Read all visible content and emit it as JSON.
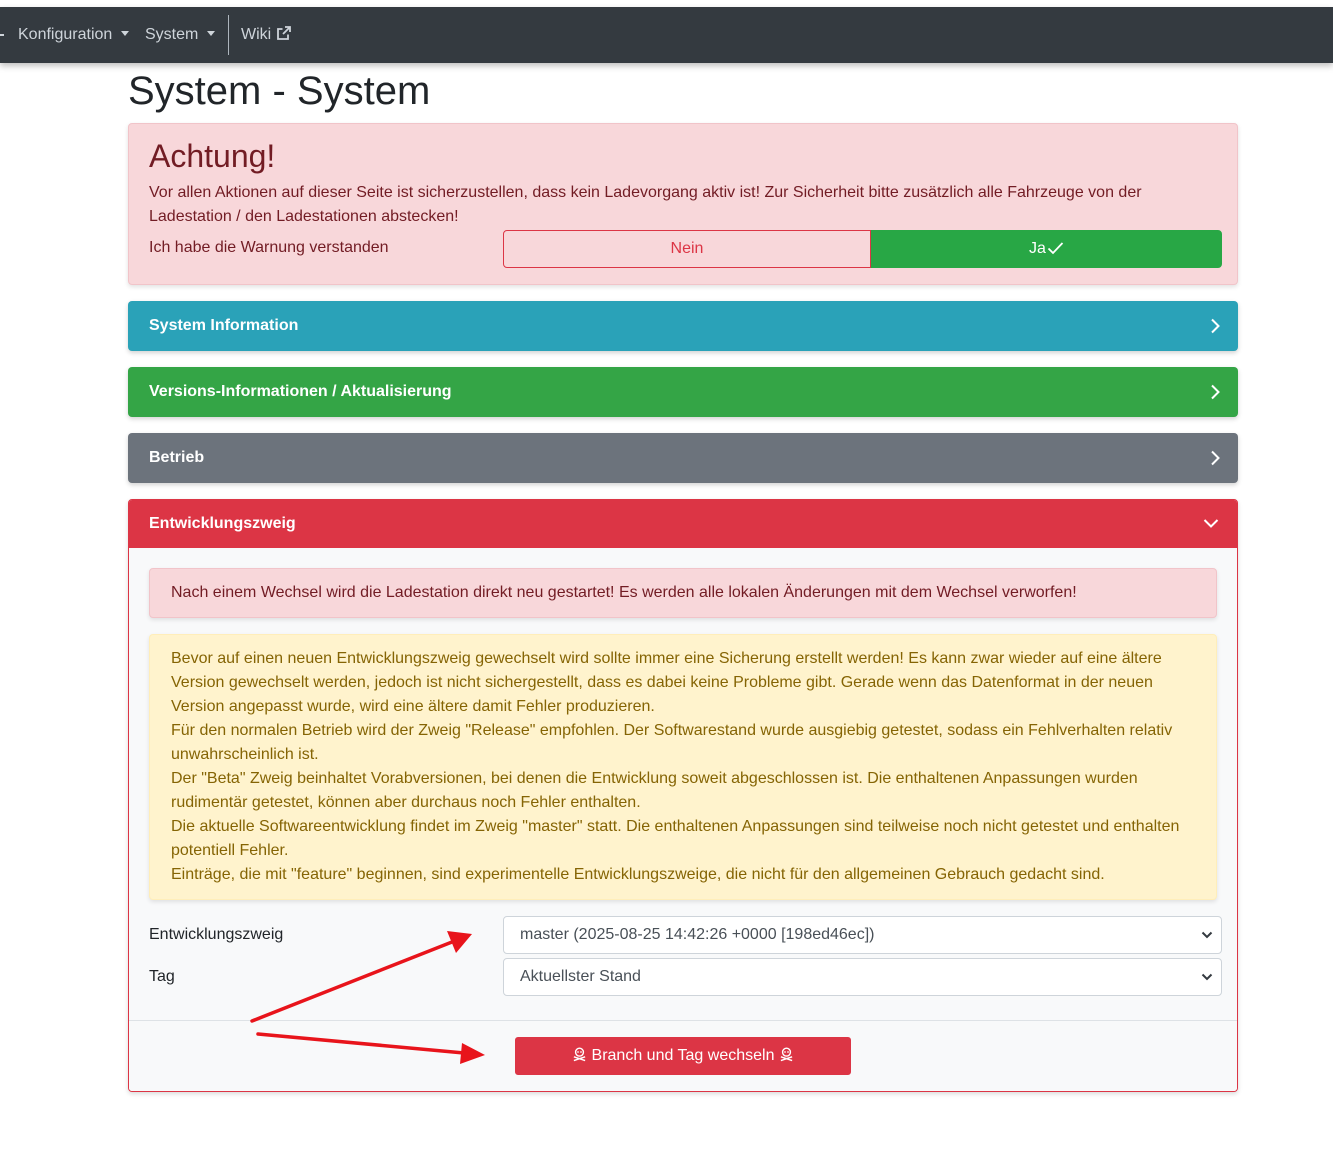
{
  "navbar": {
    "items": [
      {
        "label": "Konfiguration",
        "has_dropdown": true
      },
      {
        "label": "System",
        "has_dropdown": true
      },
      {
        "label": "Wiki",
        "icon": "external-link-icon"
      }
    ]
  },
  "page": {
    "title": "System - System"
  },
  "warning": {
    "title": "Achtung!",
    "text": "Vor allen Aktionen auf dieser Seite ist sicherzustellen, dass kein Ladevorgang aktiv ist! Zur Sicherheit bitte zusätzlich alle Fahrzeuge von der Ladestation / den Ladestationen abstecken!",
    "ack_label": "Ich habe die Warnung verstanden",
    "no_label": "Nein",
    "yes_label": "Ja",
    "selected": "Ja"
  },
  "panels": [
    {
      "title": "System Information",
      "state": "collapsed",
      "color": "#2aa2b8"
    },
    {
      "title": "Versions-Informationen / Aktualisierung",
      "state": "collapsed",
      "color": "#34a546"
    },
    {
      "title": "Betrieb",
      "state": "collapsed",
      "color": "#6c737c"
    },
    {
      "title": "Entwicklungszweig",
      "state": "expanded",
      "color": "#dc3545"
    }
  ],
  "dev": {
    "danger_text": "Nach einem Wechsel wird die Ladestation direkt neu gestartet! Es werden alle lokalen Änderungen mit dem Wechsel verworfen!",
    "warning_lines": [
      "Bevor auf einen neuen Entwicklungszweig gewechselt wird sollte immer eine Sicherung erstellt werden! Es kann zwar wieder auf eine ältere Version gewechselt werden, jedoch ist nicht sichergestellt, dass es dabei keine Probleme gibt. Gerade wenn das Datenformat in der neuen Version angepasst wurde, wird eine ältere damit Fehler produzieren.",
      "Für den normalen Betrieb wird der Zweig \"Release\" empfohlen. Der Softwarestand wurde ausgiebig getestet, sodass ein Fehlverhalten relativ unwahrscheinlich ist.",
      "Der \"Beta\" Zweig beinhaltet Vorabversionen, bei denen die Entwicklung soweit abgeschlossen ist. Die enthaltenen Anpassungen wurden rudimentär getestet, können aber durchaus noch Fehler enthalten.",
      "Die aktuelle Softwareentwicklung findet im Zweig \"master\" statt. Die enthaltenen Anpassungen sind teilweise noch nicht getestet und enthalten potentiell Fehler.",
      "Einträge, die mit \"feature\" beginnen, sind experimentelle Entwicklungszweige, die nicht für den allgemeinen Gebrauch gedacht sind."
    ],
    "branch_label": "Entwicklungszweig",
    "branch_value": "master (2025-08-25 14:42:26 +0000 [198ed46ec])",
    "tag_label": "Tag",
    "tag_value": "Aktuellster Stand",
    "switch_button": "Branch und Tag wechseln"
  },
  "colors": {
    "navbar": "#343a40",
    "danger": "#dc3545",
    "success": "#28a745",
    "info": "#2aa2b8",
    "secondary": "#6c737c",
    "annotation_arrow": "#e8141b"
  }
}
